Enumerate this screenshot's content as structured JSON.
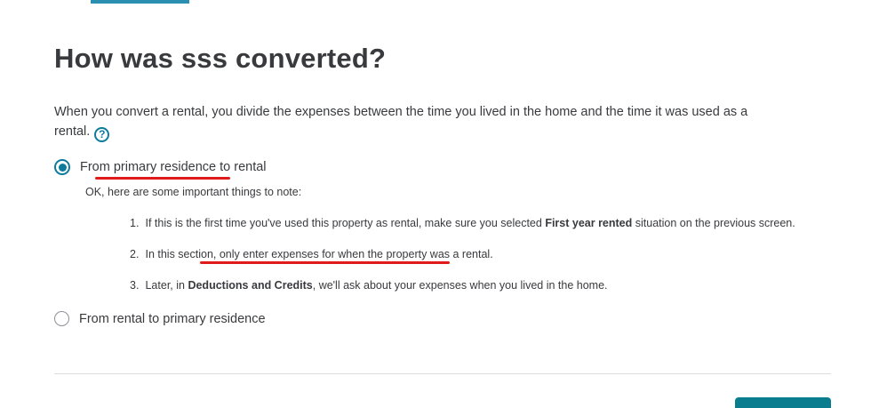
{
  "page": {
    "title": "How was sss converted?",
    "intro": "When you convert a rental, you divide the expenses between the time you lived in the home and the time it was used as a rental.",
    "help_icon_glyph": "?"
  },
  "options": [
    {
      "label": "From primary residence to rental",
      "selected": true
    },
    {
      "label": "From rental to primary residence",
      "selected": false
    }
  ],
  "notes": {
    "intro": "OK, here are some important things to note:",
    "items": [
      {
        "num": "1.",
        "pre": "If this is the first time you've used this property as rental, make sure you selected",
        "bold": "First year rented",
        "post": "situation on the previous screen."
      },
      {
        "num": "2.",
        "text": "In this section, only enter expenses for when the property was a rental."
      },
      {
        "num": "3.",
        "pre": "Later, in",
        "bold": "Deductions and Credits",
        "post": ", we'll ask about your expenses when you lived in the home."
      }
    ]
  },
  "colors": {
    "accent": "#0d7c9c",
    "annotation": "#e11b1b",
    "button": "#0a7d8f"
  }
}
